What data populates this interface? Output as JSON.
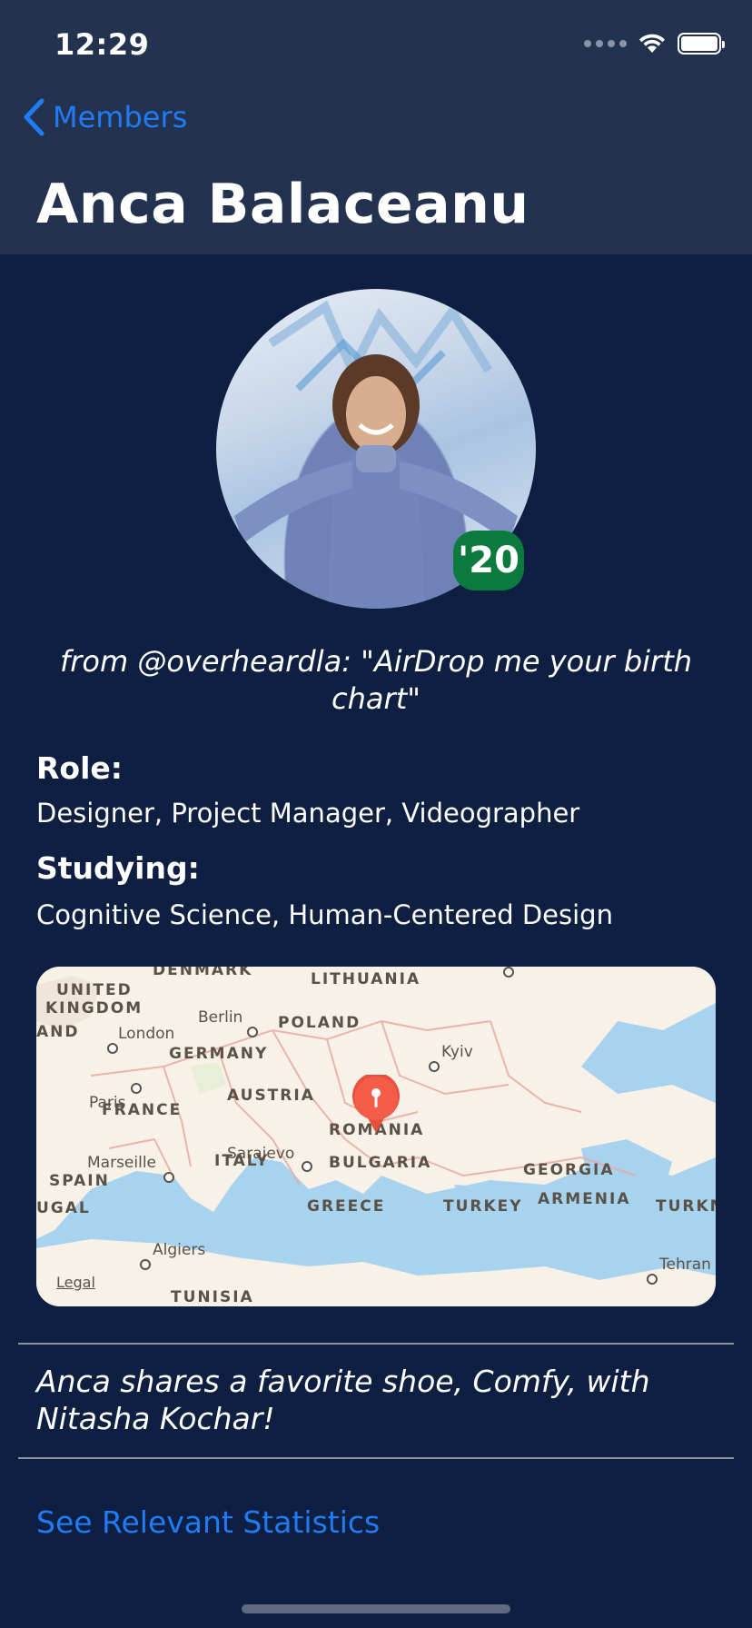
{
  "status_bar": {
    "time": "12:29"
  },
  "nav": {
    "back_label": "Members",
    "title": "Anca Balaceanu"
  },
  "profile": {
    "year_badge": "'20",
    "quote": "from @overheardla: \"AirDrop me your birth chart\"",
    "role_label": "Role:",
    "role_value": "Designer, Project Manager, Videographer",
    "studying_label": "Studying:",
    "studying_value": "Cognitive Science, Human-Centered Design"
  },
  "map": {
    "countries": [
      "DENMARK",
      "LITHUANIA",
      "UNITED",
      "KINGDOM",
      "AND",
      "POLAND",
      "GERMANY",
      "FRANCE",
      "AUSTRIA",
      "ROMANIA",
      "ITALY",
      "BULGARIA",
      "SPAIN",
      "UGAL",
      "GREECE",
      "TURKEY",
      "GEORGIA",
      "ARMENIA",
      "TURKM",
      "TUNISIA"
    ],
    "cities": [
      "Berlin",
      "London",
      "Kyiv",
      "Paris",
      "Marseille",
      "Sarajevo",
      "Algiers",
      "Tehran"
    ],
    "legal": "Legal"
  },
  "shared_note": "Anca shares a favorite shoe, Comfy, with Nitasha Kochar!",
  "stats_link": "See Relevant Statistics",
  "colors": {
    "background": "#0f1f42",
    "header": "#23324f",
    "accent": "#1f7cf6",
    "badge": "#0b7a3c"
  }
}
